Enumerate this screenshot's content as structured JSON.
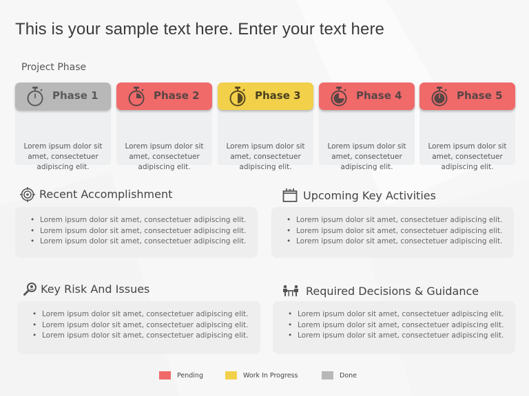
{
  "title": "This is your sample text here. Enter your text here",
  "section_label": "Project Phase",
  "colors": {
    "pending": "#f06a6a",
    "wip": "#f2d04a",
    "done": "#b8b8b8",
    "icon_stroke": "#5a4545"
  },
  "phases": [
    {
      "label": "Phase 1",
      "status": "done",
      "icon": "stopwatch-empty-icon",
      "progress": 0,
      "description": "Lorem ipsum dolor sit amet, consectetuer adipiscing elit."
    },
    {
      "label": "Phase 2",
      "status": "pending",
      "icon": "stopwatch-quarter-icon",
      "progress": 0.25,
      "description": "Lorem ipsum dolor sit amet, consectetuer adipiscing elit."
    },
    {
      "label": "Phase 3",
      "status": "wip",
      "icon": "stopwatch-half-icon",
      "progress": 0.5,
      "description": "Lorem ipsum dolor sit amet, consectetuer adipiscing elit."
    },
    {
      "label": "Phase 4",
      "status": "pending",
      "icon": "stopwatch-three-quarter-icon",
      "progress": 0.75,
      "description": "Lorem ipsum dolor sit amet, consectetuer adipiscing elit."
    },
    {
      "label": "Phase 5",
      "status": "pending",
      "icon": "stopwatch-full-icon",
      "progress": 1,
      "description": "Lorem ipsum dolor sit amet, consectetuer adipiscing elit."
    }
  ],
  "boxes": {
    "recent": {
      "title": "Recent Accomplishment",
      "icon": "target-icon",
      "items": [
        "Lorem ipsum dolor sit amet, consectetuer adipiscing elit.",
        "Lorem ipsum dolor sit amet, consectetuer adipiscing elit.",
        "Lorem ipsum dolor sit amet, consectetuer adipiscing elit."
      ]
    },
    "upcoming": {
      "title": "Upcoming Key Activities",
      "icon": "calendar-icon",
      "items": [
        "Lorem ipsum dolor sit amet, consectetuer adipiscing elit.",
        "Lorem ipsum dolor sit amet, consectetuer adipiscing elit.",
        "Lorem ipsum dolor sit amet, consectetuer adipiscing elit."
      ]
    },
    "risk": {
      "title": "Key Risk And Issues",
      "icon": "magnifier-icon",
      "items": [
        "Lorem ipsum dolor sit amet, consectetuer adipiscing elit.",
        "Lorem ipsum dolor sit amet, consectetuer adipiscing elit.",
        "Lorem ipsum dolor sit amet, consectetuer adipiscing elit."
      ]
    },
    "decisions": {
      "title": "Required Decisions & Guidance",
      "icon": "meeting-icon",
      "items": [
        "Lorem ipsum dolor sit amet, consectetuer adipiscing elit.",
        "Lorem ipsum dolor sit amet, consectetuer adipiscing elit.",
        "Lorem ipsum dolor sit amet, consectetuer adipiscing elit."
      ]
    }
  },
  "legend": [
    {
      "label": "Pending",
      "status": "pending"
    },
    {
      "label": "Work In Progress",
      "status": "wip"
    },
    {
      "label": "Done",
      "status": "done"
    }
  ]
}
